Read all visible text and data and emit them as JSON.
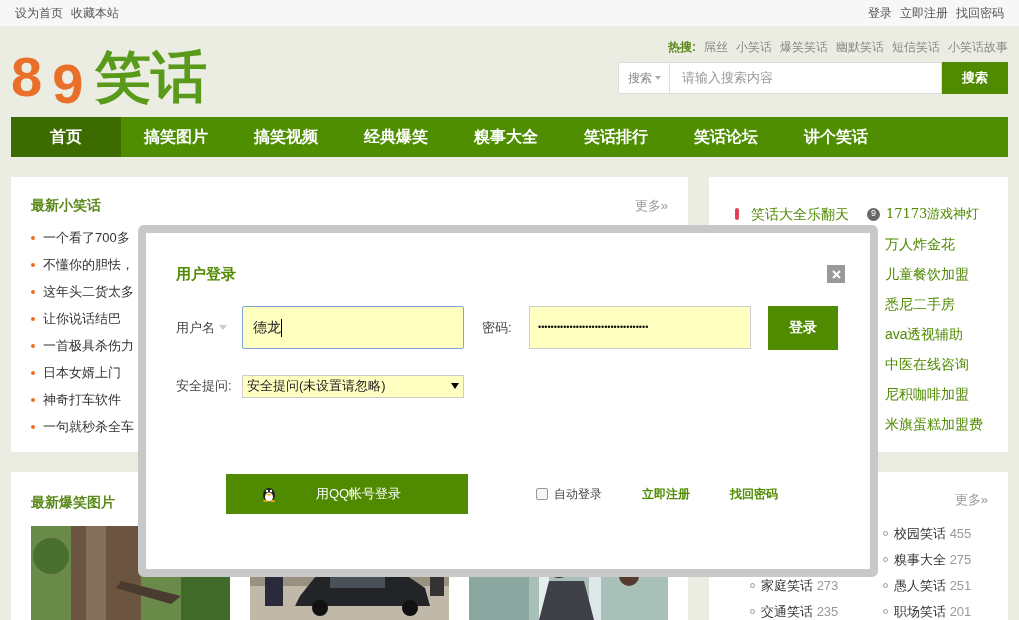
{
  "top_bar": {
    "left_links": [
      "设为首页",
      "收藏本站"
    ],
    "right_links": [
      "登录",
      "立即注册",
      "找回密码"
    ]
  },
  "logo": {
    "digits": [
      "8",
      "9"
    ],
    "word": "笑话"
  },
  "hot_search": {
    "label": "热搜:",
    "terms": [
      "屌丝",
      "小笑话",
      "爆笑笑话",
      "幽默笑话",
      "短信笑话",
      "小笑话故事"
    ]
  },
  "search": {
    "scope": "搜索",
    "placeholder": "请输入搜索内容",
    "button": "搜索"
  },
  "nav": [
    {
      "label": "首页",
      "selected": true
    },
    {
      "label": "搞笑图片",
      "selected": false
    },
    {
      "label": "搞笑视频",
      "selected": false
    },
    {
      "label": "经典爆笑",
      "selected": false
    },
    {
      "label": "糗事大全",
      "selected": false
    },
    {
      "label": "笑话排行",
      "selected": false
    },
    {
      "label": "笑话论坛",
      "selected": false
    },
    {
      "label": "讲个笑话",
      "selected": false
    }
  ],
  "latest_jokes": {
    "title": "最新小笑话",
    "more": "更多»",
    "items": [
      "一个看了700多",
      "不懂你的胆怯，",
      "这年头二货太多",
      "让你说话结巴",
      "一首极具杀伤力",
      "日本女婿上门",
      "神奇打车软件",
      "一句就秒杀全车"
    ]
  },
  "ads": {
    "featured": "笑话大全乐翻天",
    "numbered": {
      "number": "9",
      "label": "17173游戏神灯"
    },
    "items": [
      "万人炸金花",
      "儿童餐饮加盟",
      "悉尼二手房",
      "ava透视辅助",
      "中医在线咨询",
      "尼积咖啡加盟",
      "米旗蛋糕加盟费"
    ]
  },
  "latest_pictures": {
    "title": "最新爆笑图片"
  },
  "categories": {
    "more": "更多»",
    "rows": [
      {
        "right": {
          "name": "校园笑话",
          "count": "455"
        }
      },
      {
        "right": {
          "name": "糗事大全",
          "count": "275"
        }
      },
      {
        "left": {
          "name": "家庭笑话",
          "count": "273"
        },
        "right": {
          "name": "愚人笑话",
          "count": "251"
        }
      },
      {
        "left": {
          "name": "交通笑话",
          "count": "235"
        },
        "right": {
          "name": "职场笑话",
          "count": "201"
        }
      }
    ]
  },
  "login_dialog": {
    "title": "用户登录",
    "username_label": "用户名",
    "username": "德龙",
    "password_label": "密码:",
    "password": "•••••••••••••••••••••••••••••••••••",
    "login_button": "登录",
    "question_label": "安全提问:",
    "question": "安全提问(未设置请忽略)",
    "qq_button": "用QQ帐号登录",
    "auto_login": {
      "label": "自动登录",
      "checked": false
    },
    "register": "立即注册",
    "recover": "找回密码"
  }
}
